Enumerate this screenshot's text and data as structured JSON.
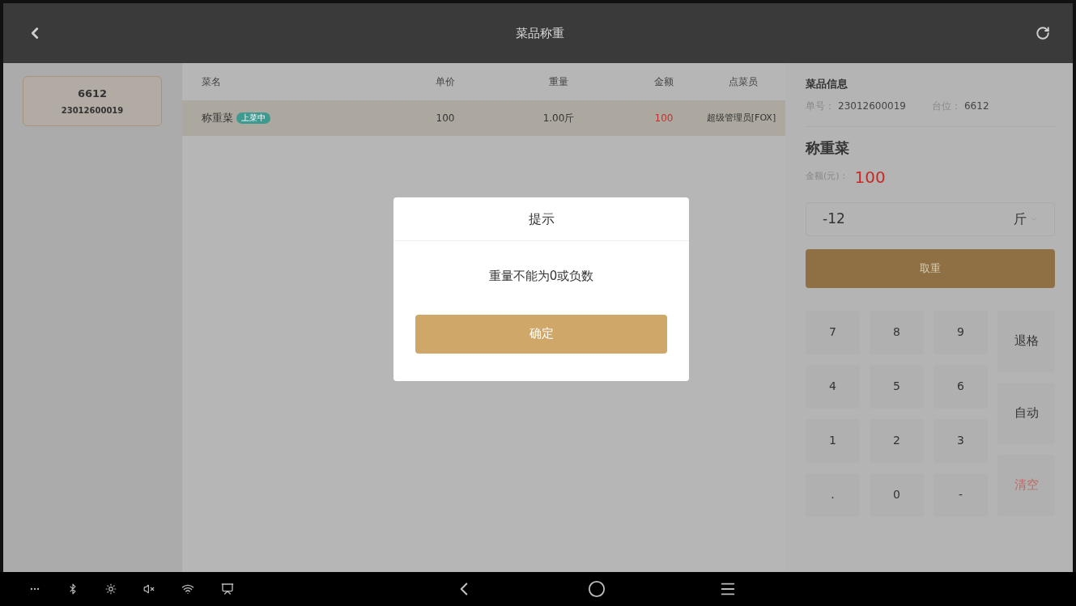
{
  "top_bar": {
    "title": "菜品称重"
  },
  "orders": [
    {
      "table": "6612",
      "number": "23012600019",
      "selected": true
    }
  ],
  "table": {
    "columns": [
      "菜名",
      "单价",
      "重量",
      "金额",
      "点菜员"
    ],
    "rows": [
      {
        "name": "称重菜",
        "badge": "上菜中",
        "price": "100",
        "weight": "1.00斤",
        "amount": "100",
        "staff": "超级管理员[FOX]",
        "selected": true
      }
    ]
  },
  "info": {
    "title": "菜品信息",
    "order_label": "单号：",
    "order_no": "23012600019",
    "table_label": "台位：",
    "table_no": "6612",
    "dish": "称重菜",
    "amount_label": "金额(元)：",
    "amount": "100",
    "weight_value": "-12",
    "unit": "斤",
    "weigh_button": "取重"
  },
  "keypad": {
    "digits": [
      "7",
      "8",
      "9",
      "4",
      "5",
      "6",
      "1",
      "2",
      "3",
      ".",
      "0",
      "-"
    ],
    "actions": [
      {
        "label": "退格",
        "kind": "normal"
      },
      {
        "label": "自动",
        "kind": "normal"
      },
      {
        "label": "清空",
        "kind": "danger"
      }
    ]
  },
  "dialog": {
    "title": "提示",
    "message": "重量不能为0或负数",
    "confirm": "确定"
  }
}
